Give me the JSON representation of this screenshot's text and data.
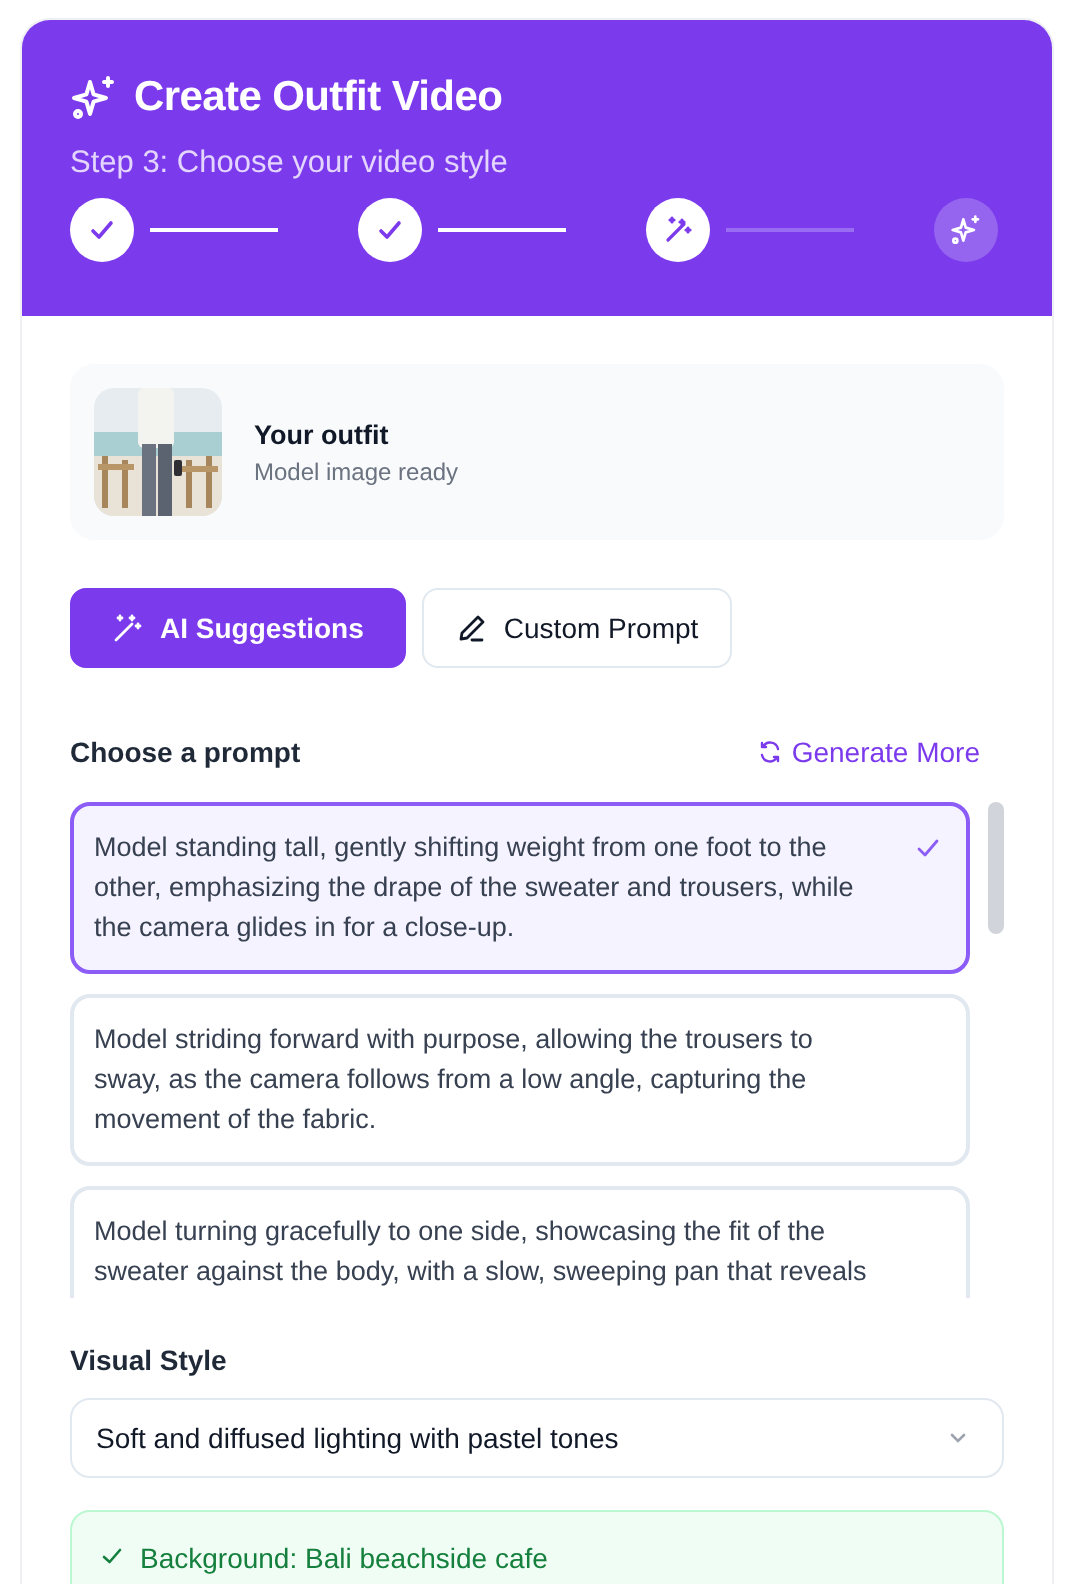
{
  "header": {
    "title": "Create Outfit Video",
    "subtitle": "Step 3: Choose your video style"
  },
  "steps": [
    {
      "kind": "done"
    },
    {
      "kind": "done"
    },
    {
      "kind": "current"
    },
    {
      "kind": "upcoming"
    }
  ],
  "outfit": {
    "title": "Your outfit",
    "subtitle": "Model image ready"
  },
  "modes": [
    {
      "label": "AI Suggestions",
      "kind": "wand",
      "selected": true
    },
    {
      "label": "Custom Prompt",
      "kind": "pen",
      "selected": false
    }
  ],
  "prompts_heading": "Choose a prompt",
  "generate_more": "Generate More",
  "prompts": [
    {
      "text": "Model standing tall, gently shifting weight from one foot to the other, emphasizing the drape of the sweater and trousers, while the camera glides in for a close-up.",
      "selected": true
    },
    {
      "text": "Model striding forward with purpose, allowing the trousers to sway, as the camera follows from a low angle, capturing the movement of the fabric.",
      "selected": false
    },
    {
      "text": "Model turning gracefully to one side, showcasing the fit of the sweater against the body, with a slow, sweeping pan that reveals",
      "selected": false
    }
  ],
  "visual_style": {
    "label": "Visual Style",
    "value": "Soft and diffused lighting with pastel tones"
  },
  "background_note": "Background: Bali beachside cafe"
}
